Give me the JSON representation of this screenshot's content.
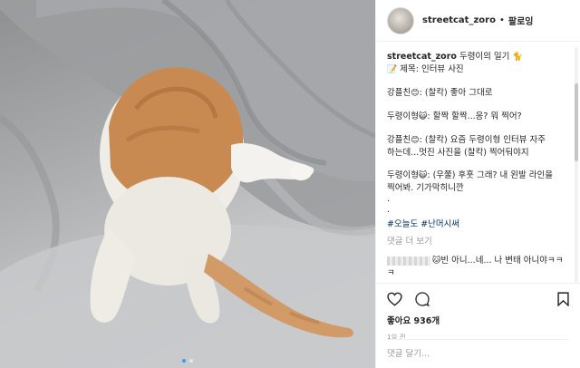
{
  "header": {
    "username": "streetcat_zoro",
    "separator": "•",
    "follow_label": "팔로잉"
  },
  "caption": {
    "username": "streetcat_zoro",
    "title": "두령이의 일기",
    "title_emoji": "🐈",
    "subject_emoji": "📝",
    "subject": "제목: 인터뷰 사진"
  },
  "dialogue": [
    {
      "speaker": "강플친",
      "emoji": "😊",
      "text": ": (찰칵) 좋아 그대로"
    },
    {
      "speaker": "두령이형",
      "emoji": "😺",
      "text": ": 할짝 할짝...응? 뭐 찍어?"
    },
    {
      "speaker": "강플친",
      "emoji": "😊",
      "text": ": (찰칵) 요즘 두령이형 인터뷰 자주 하는데...멋진 사진을 (찰칵) 찍어둬야지"
    },
    {
      "speaker": "두령이형",
      "emoji": "😺",
      "text": ": (우쭐) 후훗 그래? 내 왼발 라인을 찍어봐. 기가막히니깐"
    }
  ],
  "dots": [
    ".",
    "."
  ],
  "hashtags": [
    "#오늘도",
    "#난머시써"
  ],
  "more_comments": "댓글 더 보기",
  "comment": {
    "emoji": "🐱",
    "text": "빈 아니...네... 나 변태 아니야ㅋㅋㅋ"
  },
  "likes": "좋아요 936개",
  "time": "1일 전",
  "add_comment_placeholder": "댓글 달기...",
  "icons": {
    "like": "heart-icon",
    "comment": "comment-icon",
    "bookmark": "bookmark-icon"
  },
  "carousel": {
    "count": 2,
    "active_index": 0,
    "active_color": "#3897f0"
  }
}
